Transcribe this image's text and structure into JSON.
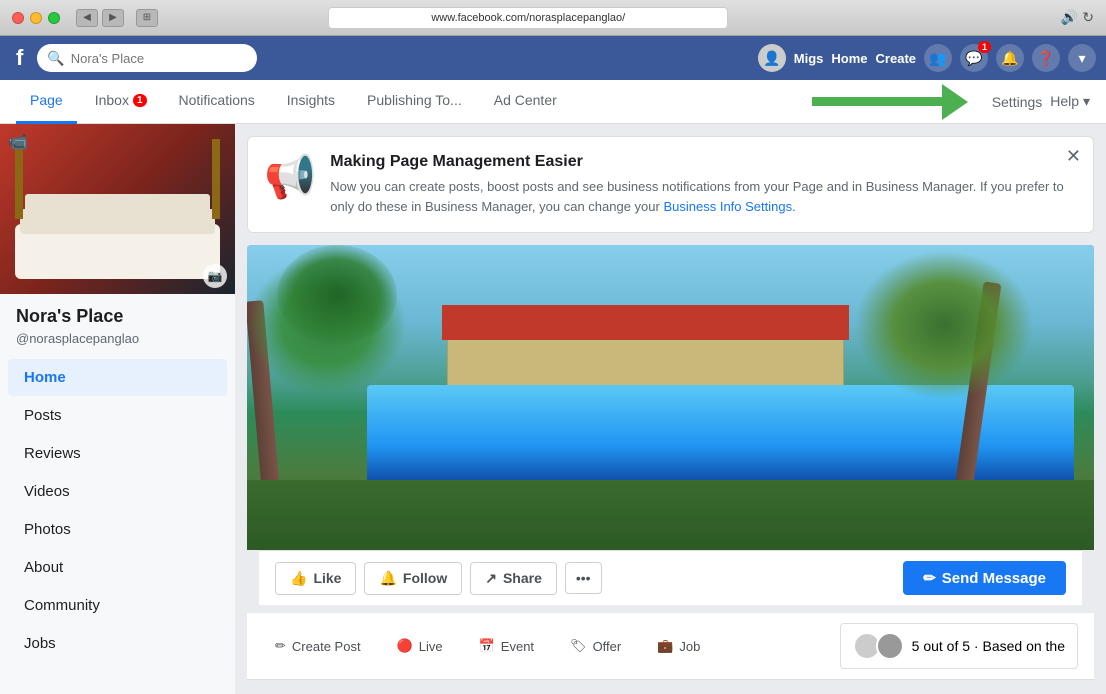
{
  "titleBar": {
    "url": "www.facebook.com/norasplacepanglao/",
    "backBtn": "◀",
    "forwardBtn": "▶"
  },
  "fbNav": {
    "searchPlaceholder": "Nora's Place",
    "username": "Migs",
    "links": [
      "Home",
      "Create"
    ],
    "iconBadge": "1"
  },
  "tabs": {
    "items": [
      {
        "label": "Page",
        "active": true
      },
      {
        "label": "Inbox",
        "badge": "1"
      },
      {
        "label": "Notifications"
      },
      {
        "label": "Insights"
      },
      {
        "label": "Publishing To..."
      },
      {
        "label": "Ad Center"
      }
    ],
    "settings": "Settings",
    "help": "Help ▾"
  },
  "banner": {
    "title": "Making Page Management Easier",
    "body": "Now you can create posts, boost posts and see business notifications from your Page and in Business Manager. If you prefer to only do these in Business Manager, you can change your",
    "link": "Business Info Settings."
  },
  "sidebar": {
    "pageName": "Nora's Place",
    "pageHandle": "@norasplacepanglao",
    "navItems": [
      {
        "label": "Home",
        "active": true
      },
      {
        "label": "Posts"
      },
      {
        "label": "Reviews"
      },
      {
        "label": "Videos"
      },
      {
        "label": "Photos"
      },
      {
        "label": "About"
      },
      {
        "label": "Community"
      },
      {
        "label": "Jobs"
      }
    ]
  },
  "actionRow": {
    "likeLabel": "Like",
    "followLabel": "Follow",
    "shareLabel": "Share",
    "moreLabel": "•••",
    "sendMessageLabel": "Send Message",
    "sendMessageIcon": "✏"
  },
  "createPostRow": {
    "createPostLabel": "Create Post",
    "liveLabel": "Live",
    "eventLabel": "Event",
    "offerLabel": "Offer",
    "jobLabel": "Job"
  },
  "ratings": {
    "text": "5 out of 5 · Based on the"
  },
  "icons": {
    "fb": "f",
    "search": "🔍",
    "camera": "📷",
    "video": "📹",
    "megaphone": "📢",
    "pencil": "✏",
    "live": "🔴",
    "like": "👍",
    "follow_icon": "🔔",
    "share_icon": "↗"
  }
}
